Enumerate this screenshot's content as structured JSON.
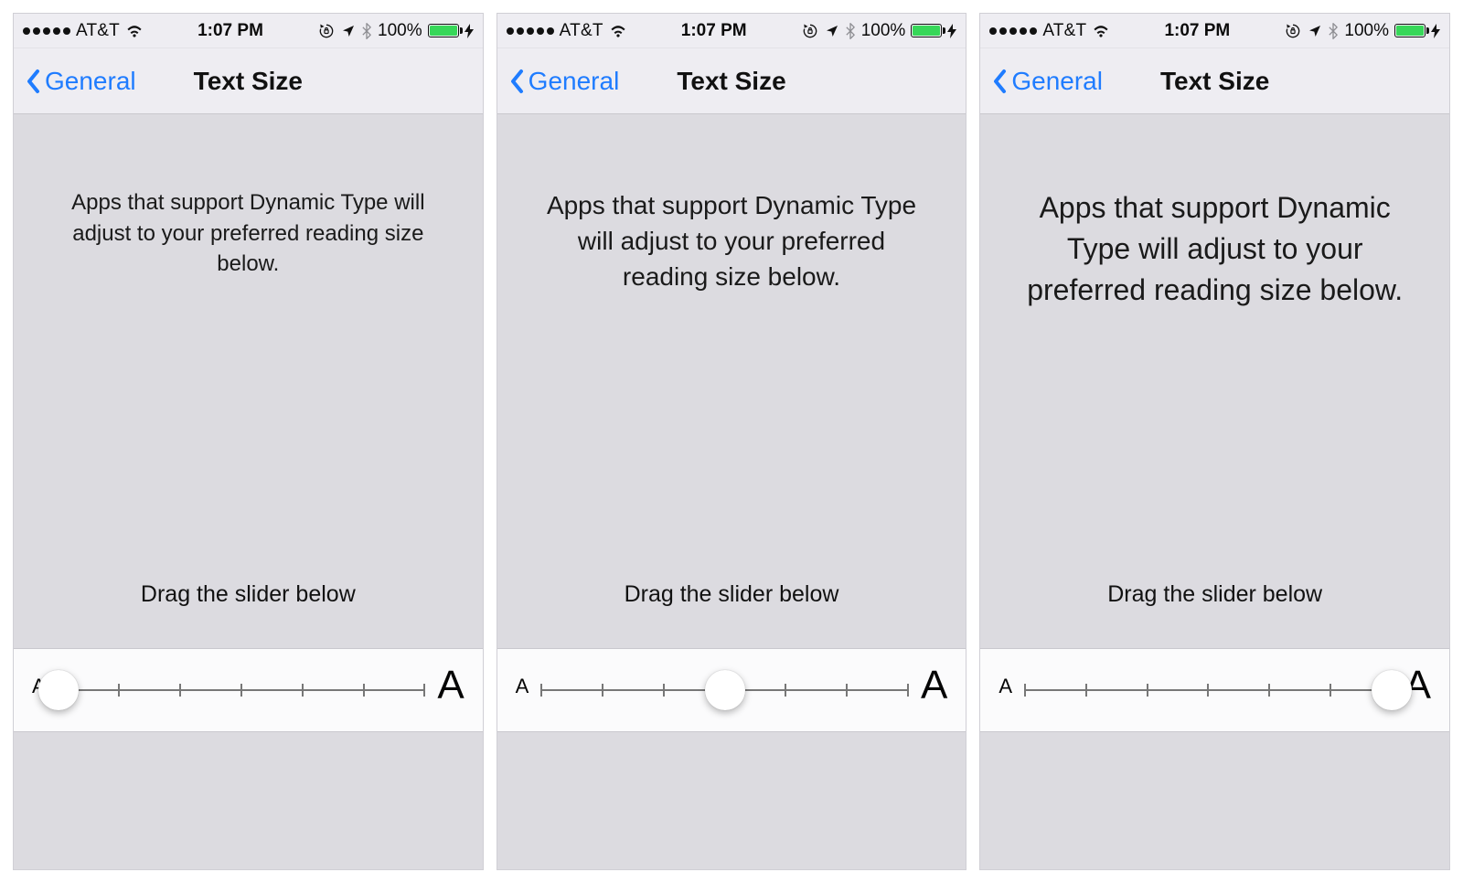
{
  "statusbar": {
    "carrier": "AT&T",
    "time": "1:07 PM",
    "battery_pct": "100%"
  },
  "navbar": {
    "back_label": "General",
    "title": "Text Size"
  },
  "body": {
    "description": "Apps that support Dynamic Type will adjust to your preferred reading size below.",
    "drag_hint": "Drag the slider below",
    "small_a": "A",
    "large_a": "A"
  },
  "slider": {
    "ticks": 7,
    "variants": {
      "small": {
        "position_pct": 0
      },
      "medium": {
        "position_pct": 50
      },
      "large": {
        "position_pct": 100
      }
    }
  },
  "screens": [
    "small",
    "medium",
    "large"
  ]
}
